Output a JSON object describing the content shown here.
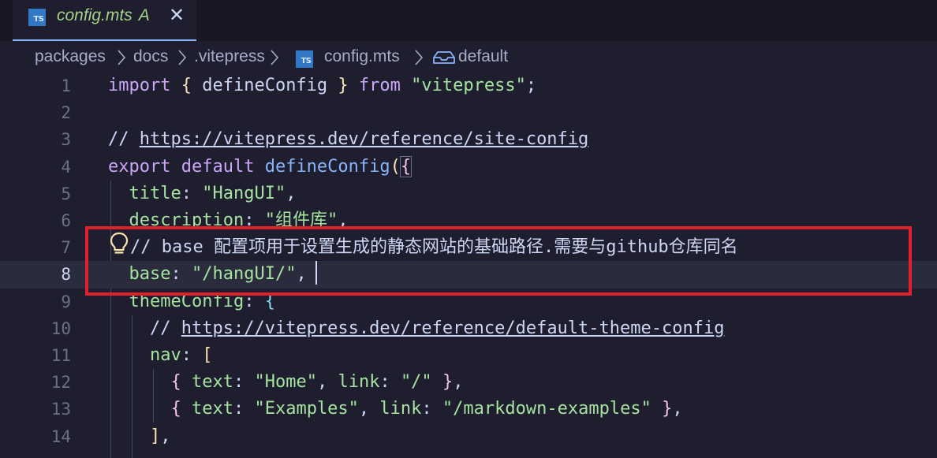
{
  "tab": {
    "icon": "typescript-file-icon",
    "badge": "TS",
    "filename": "config.mts",
    "status": "A",
    "close_glyph": "✕"
  },
  "breadcrumb": {
    "items": [
      "packages",
      "docs",
      ".vitepress",
      "config.mts",
      "default"
    ],
    "file_badge": "TS",
    "symbol_icon": "module-symbol-icon"
  },
  "editor": {
    "line_numbers": [
      "1",
      "2",
      "3",
      "4",
      "5",
      "6",
      "7",
      "8",
      "9",
      "10",
      "11",
      "12",
      "13",
      "14"
    ],
    "current_line": 8,
    "lines": {
      "l1": {
        "import": "import",
        "b_open": "{",
        "ident": " defineConfig ",
        "b_close": "}",
        "from": "from",
        "src": "\"vitepress\"",
        "semi": ";"
      },
      "l3": {
        "prefix": "// ",
        "url": "https://vitepress.dev/reference/site-config"
      },
      "l4": {
        "export": "export",
        "default": "default",
        "fn": "defineConfig",
        "paren": "(",
        "brace": "{"
      },
      "l5": {
        "key": "title",
        "colon": ": ",
        "value": "\"HangUI\"",
        "comma": ","
      },
      "l6": {
        "key": "description",
        "colon": ": ",
        "value": "\"组件库\"",
        "comma": ","
      },
      "l7": {
        "comment": "// base 配置项用于设置生成的静态网站的基础路径.需要与github仓库同名"
      },
      "l8": {
        "key": "base",
        "colon": ": ",
        "value": "\"/hangUI/\"",
        "comma": ","
      },
      "l9": {
        "key": "themeConfig",
        "colon": ": ",
        "brace": "{"
      },
      "l10": {
        "prefix": "// ",
        "url": "https://vitepress.dev/reference/default-theme-config"
      },
      "l11": {
        "key": "nav",
        "colon": ": ",
        "bracket": "["
      },
      "l12": {
        "open": "{",
        "k1": "text",
        "v1": "\"Home\"",
        "k2": "link",
        "v2": "\"/\"",
        "close": "}"
      },
      "l13": {
        "open": "{",
        "k1": "text",
        "v1": "\"Examples\"",
        "k2": "link",
        "v2": "\"/markdown-examples\"",
        "close": "}"
      },
      "l14": {
        "bracket": "]",
        "comma": ","
      }
    },
    "lightbulb_icon": "lightbulb-icon",
    "highlight_color": "#e0202a"
  }
}
